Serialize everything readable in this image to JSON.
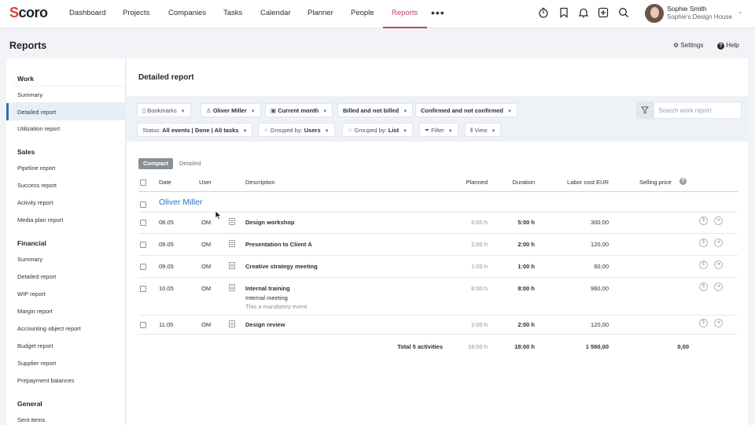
{
  "nav": {
    "logo": "Scoro",
    "items": [
      "Dashboard",
      "Projects",
      "Companies",
      "Tasks",
      "Calendar",
      "Planner",
      "People",
      "Reports"
    ],
    "active": "Reports",
    "accent_color": "#c2416a",
    "icons": [
      "timer-icon",
      "bookmark-icon",
      "bell-icon",
      "plus-square-icon",
      "search-icon"
    ]
  },
  "user": {
    "name": "Sophie Smith",
    "company": "Sophie's Design House"
  },
  "header": {
    "title": "Reports",
    "settings_label": "Settings",
    "help_label": "Help"
  },
  "sidebar": {
    "sections": [
      {
        "title": "Work",
        "items": [
          "Summary",
          "Detailed report",
          "Utilization report"
        ]
      },
      {
        "title": "Sales",
        "items": [
          "Pipeline report",
          "Success report",
          "Activity report",
          "Media plan report"
        ]
      },
      {
        "title": "Financial",
        "items": [
          "Summary",
          "Detailed report",
          "WIP report",
          "Margin report",
          "Accounting object report",
          "Budget report",
          "Supplier report",
          "Prepayment balances"
        ]
      },
      {
        "title": "General",
        "items": [
          "Sent items"
        ]
      }
    ],
    "active_item": "Detailed report",
    "active_color": "#2f70b8"
  },
  "report": {
    "title": "Detailed report",
    "filters": {
      "bookmarks": "Bookmarks",
      "user": "Oliver Miller",
      "period": "Current month",
      "billing": "Billed and not billed",
      "confirmation": "Confirmed and not confirmed",
      "status_label": "Status:",
      "status_value": "All events | Done | All tasks",
      "grouped1_label": "Grouped by:",
      "grouped1_value": "Users",
      "grouped2_label": "Grouped by:",
      "grouped2_value": "List",
      "filter": "Filter",
      "view": "View"
    },
    "search_placeholder": "Search work report",
    "view_toggle": {
      "compact": "Compact",
      "detailed": "Detailed",
      "active": "Compact"
    },
    "columns": {
      "date": "Date",
      "user": "User",
      "description": "Description",
      "planned": "Planned",
      "duration": "Duration",
      "labor_cost": "Labor cost EUR",
      "selling_price": "Selling price"
    },
    "group": "Oliver Miller",
    "rows": [
      {
        "date": "08.05",
        "user": "OM",
        "description": "Design workshop",
        "planned": "5:00 h",
        "duration": "5:00 h",
        "labor_cost": "300,00"
      },
      {
        "date": "09.05",
        "user": "OM",
        "description": "Presentation to Client A",
        "planned": "2:00 h",
        "duration": "2:00 h",
        "labor_cost": "120,00"
      },
      {
        "date": "09.05",
        "user": "OM",
        "description": "Creative strategy meeting",
        "planned": "1:00 h",
        "duration": "1:00 h",
        "labor_cost": "60,00"
      },
      {
        "date": "10.05",
        "user": "OM",
        "description": "Internal training",
        "subtitle": "Internal meeting",
        "note": "This a mandatory event",
        "planned": "8:00 h",
        "duration": "8:00 h",
        "labor_cost": "960,00"
      },
      {
        "date": "11.05",
        "user": "OM",
        "description": "Design review",
        "planned": "2:00 h",
        "duration": "2:00 h",
        "labor_cost": "120,00"
      }
    ],
    "totals": {
      "label": "Total 5 activities",
      "planned": "18:00 h",
      "duration": "18:00 h",
      "labor_cost": "1 560,00",
      "selling_price": "0,00"
    }
  }
}
